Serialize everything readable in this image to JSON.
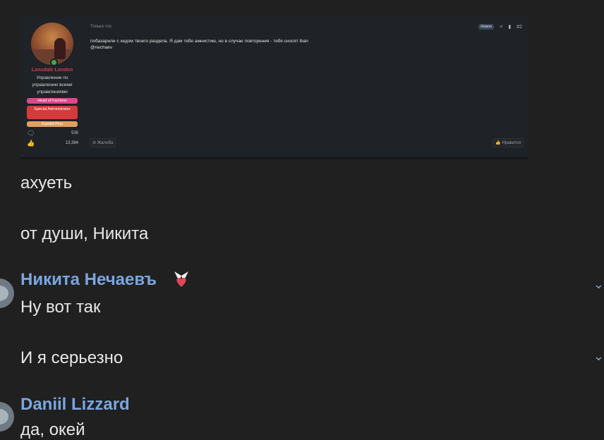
{
  "forum_post": {
    "username": "Lonsdale London",
    "user_title": "Управление по управлению всеми управлениями",
    "badges": [
      "Head of Factions",
      "Special Administrator",
      "Gambit Plus"
    ],
    "messages_count": "535",
    "reactions_count": "13,384",
    "time": "Только что",
    "new_label": "Новое",
    "post_number": "#2",
    "body_line1": "побазарили с хедом твоего раздела. Я дам тебе амнистию, но в случае повторения - тебя сносят iban",
    "body_line2": "@nechaev",
    "report_label": "Жалоба",
    "like_label": "Нравится"
  },
  "chat": {
    "messages": [
      {
        "text": "ахуеть"
      },
      {
        "text": "от души, Никита"
      }
    ],
    "group1": {
      "author": "Никита Нечаевъ",
      "messages": [
        "Ну вот так",
        "И я серьезно"
      ]
    },
    "group2": {
      "author": "Daniil Lizzard",
      "messages": [
        "да, окей"
      ]
    }
  },
  "colors": {
    "background": "#202020",
    "author_name": "#7aa6e0",
    "forum_username": "#d23b5a"
  }
}
